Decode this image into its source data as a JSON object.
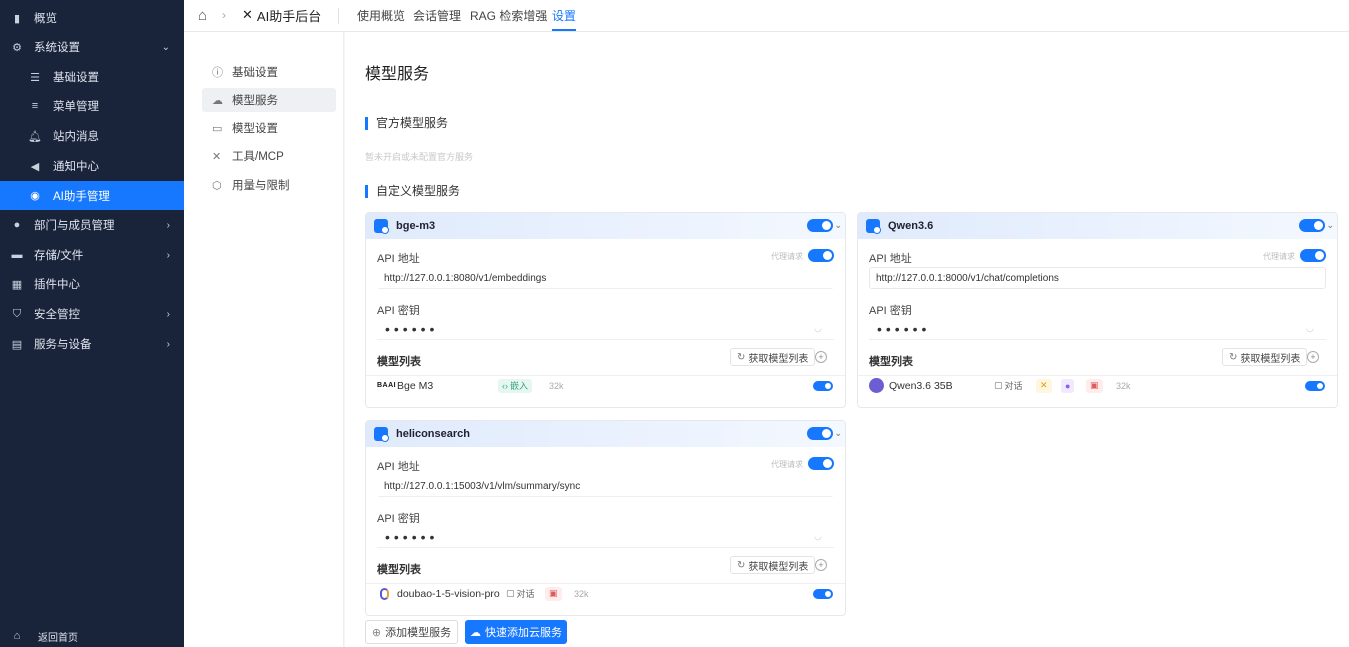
{
  "sidebar": {
    "items": [
      {
        "label": "概览",
        "icon": "bar-chart-icon"
      },
      {
        "label": "系统设置",
        "icon": "gear-icon"
      },
      {
        "label": "基础设置",
        "icon": "sliders-icon"
      },
      {
        "label": "菜单管理",
        "icon": "menu-icon"
      },
      {
        "label": "站内消息",
        "icon": "bell-icon"
      },
      {
        "label": "通知中心",
        "icon": "speaker-icon"
      },
      {
        "label": "AI助手管理",
        "icon": "ai-icon"
      },
      {
        "label": "部门与成员管理",
        "icon": "users-icon"
      },
      {
        "label": "存储/文件",
        "icon": "folder-icon"
      },
      {
        "label": "插件中心",
        "icon": "grid-icon"
      },
      {
        "label": "安全管控",
        "icon": "shield-icon"
      },
      {
        "label": "服务与设备",
        "icon": "server-icon"
      }
    ],
    "back_home": "返回首页"
  },
  "topbar": {
    "app_title": "AI助手后台",
    "tabs": [
      "使用概览",
      "会话管理",
      "RAG 检索增强",
      "设置"
    ]
  },
  "settings_nav": [
    "基础设置",
    "模型服务",
    "模型设置",
    "工具/MCP",
    "用量与限制"
  ],
  "main": {
    "title": "模型服务",
    "official_section": "官方模型服务",
    "official_hint": "暂未开启或未配置官方服务",
    "custom_section": "自定义模型服务",
    "add_button": "添加模型服务",
    "quick_add_button": "快速添加云服务"
  },
  "common": {
    "api_url_label": "API 地址",
    "api_key_label": "API 密钥",
    "proxy_label": "代理请求",
    "model_list_label": "模型列表",
    "fetch_models": "获取模型列表",
    "masked_key": "••••••"
  },
  "services": [
    {
      "name": "bge-m3",
      "api_url": "http://127.0.0.1:8080/v1/embeddings",
      "model": {
        "vendor": "BAAI",
        "name": "Bge M3",
        "tags": [
          "嵌入"
        ],
        "context": "32k"
      }
    },
    {
      "name": "Qwen3.6",
      "api_url": "http://127.0.0.1:8000/v1/chat/completions",
      "model": {
        "name": "Qwen3.6 35B",
        "tags": [
          "对话"
        ],
        "context": "32k"
      }
    },
    {
      "name": "heliconsearch",
      "api_url": "http://127.0.0.1:15003/v1/vlm/summary/sync",
      "model": {
        "name": "doubao-1-5-vision-pro",
        "tags": [
          "对话"
        ],
        "context": "32k"
      }
    }
  ],
  "colors": {
    "accent": "#1677ff",
    "sidebar_bg": "#19233a"
  }
}
